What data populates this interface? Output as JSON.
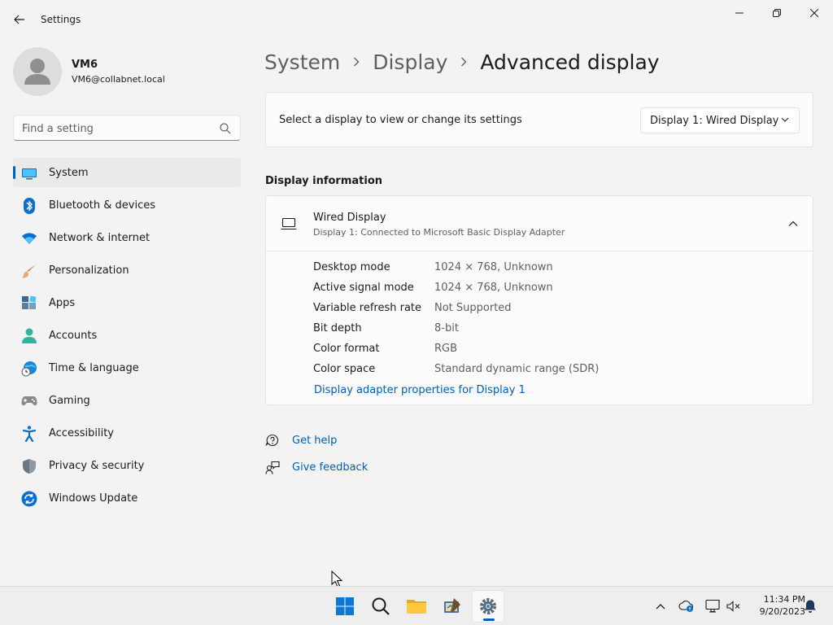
{
  "window": {
    "title": "Settings"
  },
  "user": {
    "name": "VM6",
    "email": "VM6@collabnet.local"
  },
  "search": {
    "placeholder": "Find a setting"
  },
  "sidebar": {
    "items": [
      {
        "label": "System",
        "icon": "system-icon",
        "selected": true
      },
      {
        "label": "Bluetooth & devices",
        "icon": "bluetooth-icon"
      },
      {
        "label": "Network & internet",
        "icon": "wifi-icon"
      },
      {
        "label": "Personalization",
        "icon": "brush-icon"
      },
      {
        "label": "Apps",
        "icon": "apps-icon"
      },
      {
        "label": "Accounts",
        "icon": "person-icon"
      },
      {
        "label": "Time & language",
        "icon": "globe-clock-icon"
      },
      {
        "label": "Gaming",
        "icon": "gamepad-icon"
      },
      {
        "label": "Accessibility",
        "icon": "accessibility-icon"
      },
      {
        "label": "Privacy & security",
        "icon": "shield-icon"
      },
      {
        "label": "Windows Update",
        "icon": "update-icon"
      }
    ]
  },
  "breadcrumb": {
    "items": [
      "System",
      "Display",
      "Advanced display"
    ]
  },
  "display_select": {
    "label": "Select a display to view or change its settings",
    "selected": "Display 1: Wired Display"
  },
  "display_info": {
    "section_title": "Display information",
    "name": "Wired Display",
    "subtitle": "Display 1: Connected to Microsoft Basic Display Adapter",
    "rows": [
      {
        "label": "Desktop mode",
        "value": "1024 × 768, Unknown"
      },
      {
        "label": "Active signal mode",
        "value": "1024 × 768, Unknown"
      },
      {
        "label": "Variable refresh rate",
        "value": "Not Supported"
      },
      {
        "label": "Bit depth",
        "value": "8-bit"
      },
      {
        "label": "Color format",
        "value": "RGB"
      },
      {
        "label": "Color space",
        "value": "Standard dynamic range (SDR)"
      }
    ],
    "adapter_link": "Display adapter properties for Display 1"
  },
  "help": {
    "get_help": "Get help",
    "give_feedback": "Give feedback"
  },
  "taskbar": {
    "apps": [
      "start-icon",
      "search-icon",
      "file-explorer-icon",
      "app-icon",
      "settings-icon"
    ],
    "active_app": "settings-icon",
    "tray_icons": [
      "chevron-up-icon",
      "onedrive-icon",
      "network-icon",
      "volume-muted-icon",
      "notification-bell-icon"
    ]
  },
  "clock": {
    "time": "11:34 PM",
    "date": "9/20/2023"
  },
  "colors": {
    "accent": "#005fb8",
    "background": "#f3f3f3",
    "card": "#fbfbfb",
    "text_primary": "#1b1b1b",
    "text_secondary": "#5f5f5f"
  }
}
